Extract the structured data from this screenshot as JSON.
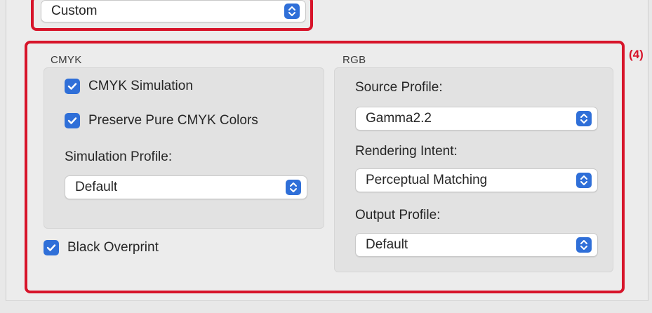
{
  "top_popup": {
    "value": "Custom"
  },
  "annotation": {
    "label": "(4)"
  },
  "cmyk": {
    "title": "CMYK",
    "simulation": {
      "label": "CMYK Simulation",
      "checked": true
    },
    "preserve": {
      "label": "Preserve Pure CMYK Colors",
      "checked": true
    },
    "profile_label": "Simulation Profile:",
    "profile_value": "Default"
  },
  "black_overprint": {
    "label": "Black Overprint",
    "checked": true
  },
  "rgb": {
    "title": "RGB",
    "source_label": "Source Profile:",
    "source_value": "Gamma2.2",
    "intent_label": "Rendering Intent:",
    "intent_value": "Perceptual Matching",
    "output_label": "Output Profile:",
    "output_value": "Default"
  },
  "colors": {
    "accent": "#2f6fd8",
    "highlight": "#d7142a"
  }
}
